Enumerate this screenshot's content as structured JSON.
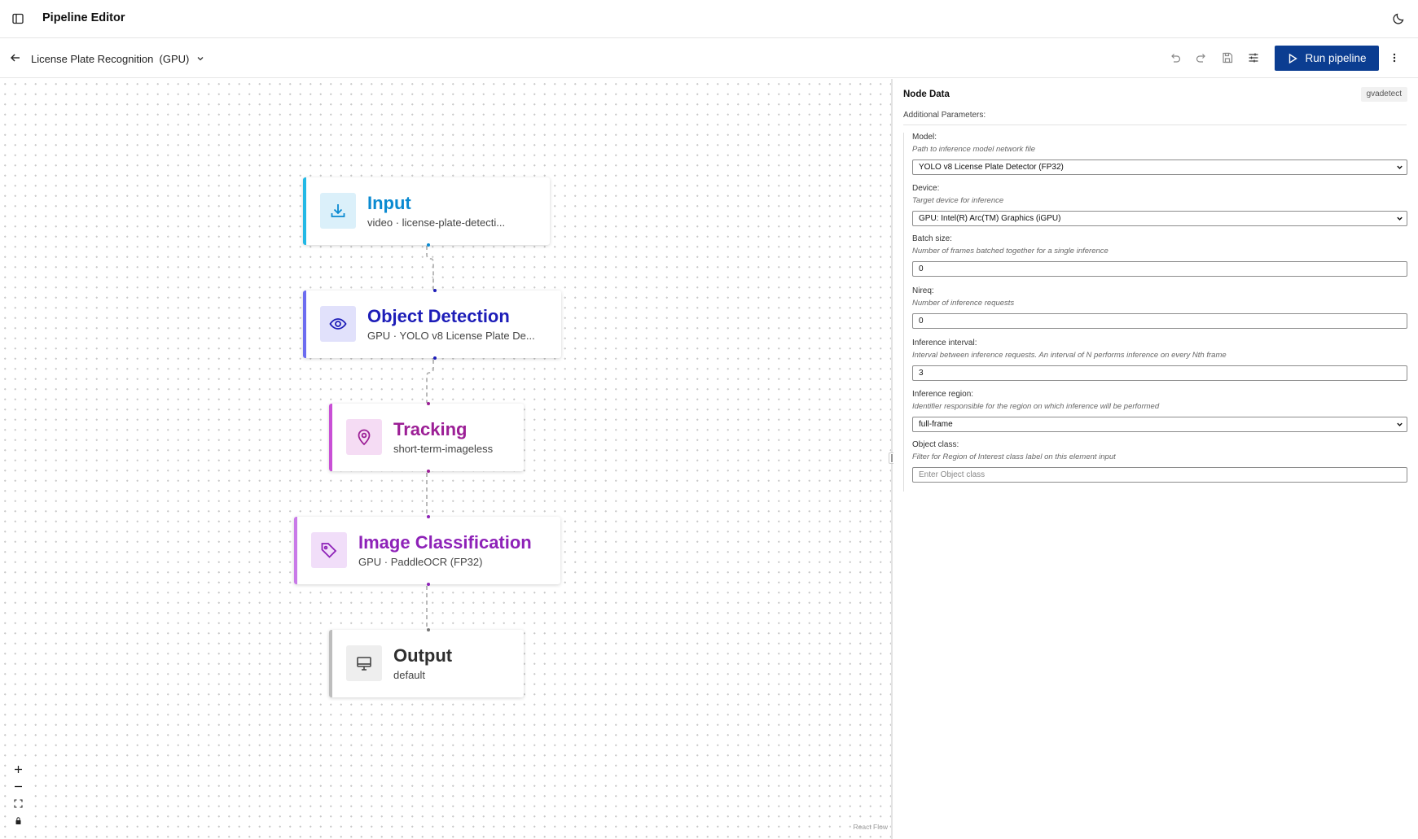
{
  "header": {
    "title": "Pipeline Editor"
  },
  "toolbar": {
    "pipeline_name": "License Plate Recognition  (GPU)",
    "run_label": "Run pipeline",
    "accent_color": "#0b3d91"
  },
  "nodes": [
    {
      "title": "Input",
      "subtitle": "video · license-plate-detecti...",
      "color": "#0a8ad1",
      "icon": "download-icon"
    },
    {
      "title": "Object Detection",
      "subtitle": "GPU · YOLO v8 License Plate De...",
      "color": "#1d1db8",
      "icon": "eye-icon"
    },
    {
      "title": "Tracking",
      "subtitle": "short-term-imageless",
      "color": "#9c1f96",
      "icon": "location-pin-icon"
    },
    {
      "title": "Image Classification",
      "subtitle": "GPU · PaddleOCR (FP32)",
      "color": "#8e22b8",
      "icon": "tag-icon"
    },
    {
      "title": "Output",
      "subtitle": "default",
      "color": "#2f2f2f",
      "icon": "monitor-icon"
    }
  ],
  "canvas": {
    "attribution": "React Flow"
  },
  "panel": {
    "title": "Node Data",
    "badge": "gvadetect",
    "section": "Additional Parameters:",
    "params": [
      {
        "label": "Model:",
        "description": "Path to inference model network file",
        "value": "YOLO v8 License Plate Detector (FP32)",
        "type": "select"
      },
      {
        "label": "Device:",
        "description": "Target device for inference",
        "value": "GPU: Intel(R) Arc(TM) Graphics (iGPU)",
        "type": "select"
      },
      {
        "label": "Batch size:",
        "description": "Number of frames batched together for a single inference",
        "value": "0",
        "type": "input"
      },
      {
        "label": "Nireq:",
        "description": "Number of inference requests",
        "value": "0",
        "type": "input"
      },
      {
        "label": "Inference interval:",
        "description": "Interval between inference requests. An interval of N performs inference on every Nth frame",
        "value": "3",
        "type": "input"
      },
      {
        "label": "Inference region:",
        "description": "Identifier responsible for the region on which inference will be performed",
        "value": "full-frame",
        "type": "select"
      },
      {
        "label": "Object class:",
        "description": "Filter for Region of Interest class label on this element input",
        "value": "",
        "placeholder": "Enter Object class",
        "type": "input"
      }
    ]
  }
}
